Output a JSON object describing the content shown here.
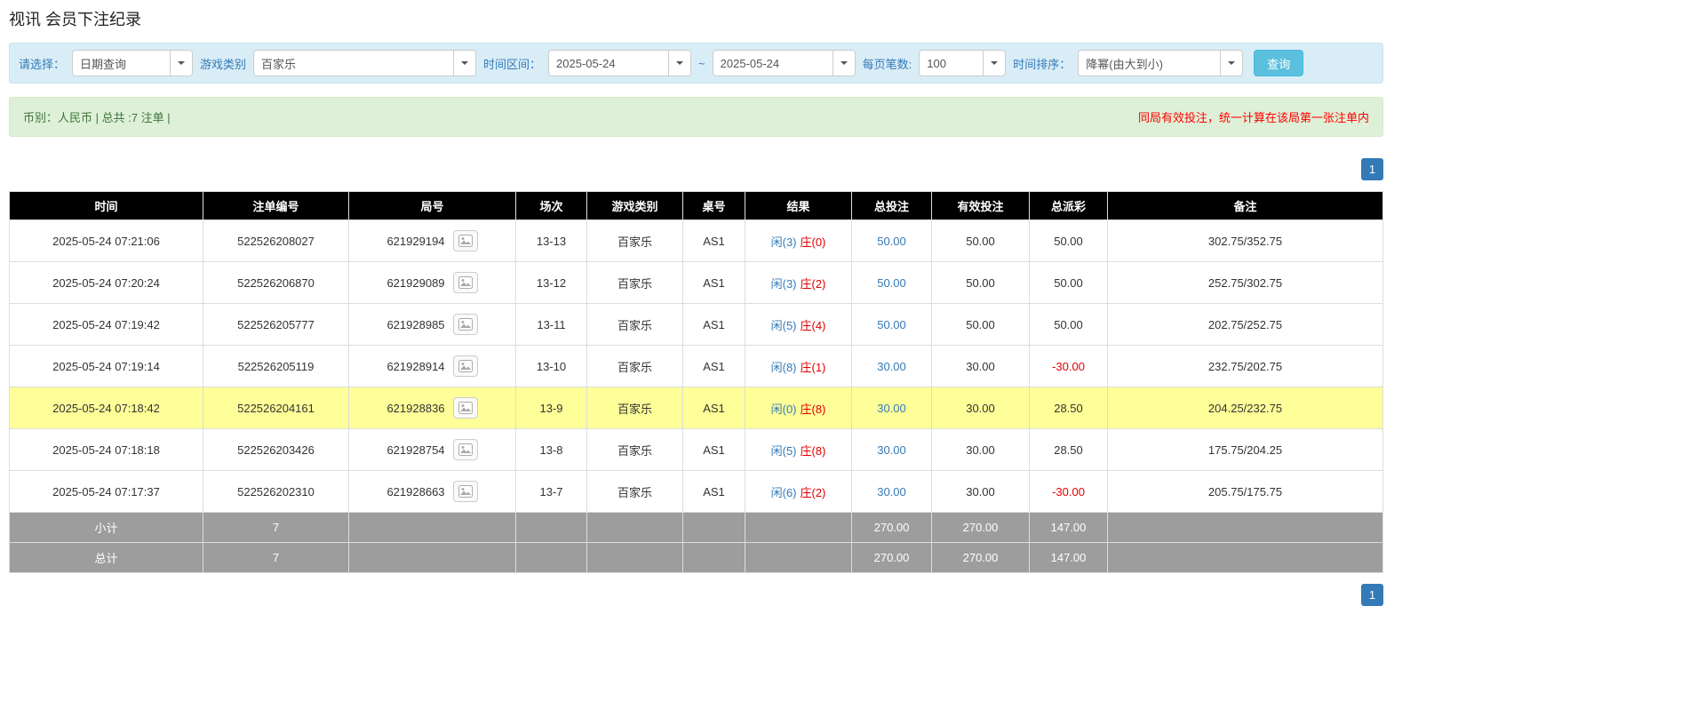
{
  "page": {
    "title": "视讯 会员下注纪录"
  },
  "filters": {
    "select_label": "请选择：",
    "select_value": "日期查询",
    "game_type_label": "游戏类别",
    "game_type_value": "百家乐",
    "time_range_label": "时间区间：",
    "date_from": "2025-05-24",
    "range_separator": "~",
    "date_to": "2025-05-24",
    "page_size_label": "每页笔数:",
    "page_size_value": "100",
    "sort_label": "时间排序：",
    "sort_value": "降幂(由大到小)",
    "search_button": "查询"
  },
  "summary": {
    "left": "币别：人民币 | 总共 :7 注单 |",
    "right": "同局有效投注，统一计算在该局第一张注单内"
  },
  "pagination": {
    "page": "1"
  },
  "colors": {
    "accent_blue": "#337ab7",
    "filter_bar_bg": "#d9edf7",
    "summary_bar_bg": "#dff0d8",
    "summary_text_green": "#3c763d",
    "warning_red": "#ff0000",
    "table_header_bg": "#000000",
    "highlight_row": "#ffff99",
    "footer_row_bg": "#9d9d9d",
    "search_button_bg": "#5bc0de",
    "negative_value": "#e00000"
  },
  "table": {
    "headers": [
      "时间",
      "注单编号",
      "局号",
      "场次",
      "游戏类别",
      "桌号",
      "结果",
      "总投注",
      "有效投注",
      "总派彩",
      "备注"
    ],
    "rows": [
      {
        "time": "2025-05-24 07:21:06",
        "bet_id": "522526208027",
        "round_id": "621929194",
        "session": "13-13",
        "game": "百家乐",
        "table_no": "AS1",
        "result_player": "闲(3)",
        "result_banker": "庄(0)",
        "total_bet": "50.00",
        "valid_bet": "50.00",
        "payout": "50.00",
        "note": "302.75/352.75",
        "highlight": false
      },
      {
        "time": "2025-05-24 07:20:24",
        "bet_id": "522526206870",
        "round_id": "621929089",
        "session": "13-12",
        "game": "百家乐",
        "table_no": "AS1",
        "result_player": "闲(3)",
        "result_banker": "庄(2)",
        "total_bet": "50.00",
        "valid_bet": "50.00",
        "payout": "50.00",
        "note": "252.75/302.75",
        "highlight": false
      },
      {
        "time": "2025-05-24 07:19:42",
        "bet_id": "522526205777",
        "round_id": "621928985",
        "session": "13-11",
        "game": "百家乐",
        "table_no": "AS1",
        "result_player": "闲(5)",
        "result_banker": "庄(4)",
        "total_bet": "50.00",
        "valid_bet": "50.00",
        "payout": "50.00",
        "note": "202.75/252.75",
        "highlight": false
      },
      {
        "time": "2025-05-24 07:19:14",
        "bet_id": "522526205119",
        "round_id": "621928914",
        "session": "13-10",
        "game": "百家乐",
        "table_no": "AS1",
        "result_player": "闲(8)",
        "result_banker": "庄(1)",
        "total_bet": "30.00",
        "valid_bet": "30.00",
        "payout": "-30.00",
        "note": "232.75/202.75",
        "highlight": false
      },
      {
        "time": "2025-05-24 07:18:42",
        "bet_id": "522526204161",
        "round_id": "621928836",
        "session": "13-9",
        "game": "百家乐",
        "table_no": "AS1",
        "result_player": "闲(0)",
        "result_banker": "庄(8)",
        "total_bet": "30.00",
        "valid_bet": "30.00",
        "payout": "28.50",
        "note": "204.25/232.75",
        "highlight": true
      },
      {
        "time": "2025-05-24 07:18:18",
        "bet_id": "522526203426",
        "round_id": "621928754",
        "session": "13-8",
        "game": "百家乐",
        "table_no": "AS1",
        "result_player": "闲(5)",
        "result_banker": "庄(8)",
        "total_bet": "30.00",
        "valid_bet": "30.00",
        "payout": "28.50",
        "note": "175.75/204.25",
        "highlight": false
      },
      {
        "time": "2025-05-24 07:17:37",
        "bet_id": "522526202310",
        "round_id": "621928663",
        "session": "13-7",
        "game": "百家乐",
        "table_no": "AS1",
        "result_player": "闲(6)",
        "result_banker": "庄(2)",
        "total_bet": "30.00",
        "valid_bet": "30.00",
        "payout": "-30.00",
        "note": "205.75/175.75",
        "highlight": false
      }
    ],
    "subtotal": {
      "label": "小计",
      "count": "7",
      "total_bet": "270.00",
      "valid_bet": "270.00",
      "payout": "147.00"
    },
    "total": {
      "label": "总计",
      "count": "7",
      "total_bet": "270.00",
      "valid_bet": "270.00",
      "payout": "147.00"
    }
  }
}
